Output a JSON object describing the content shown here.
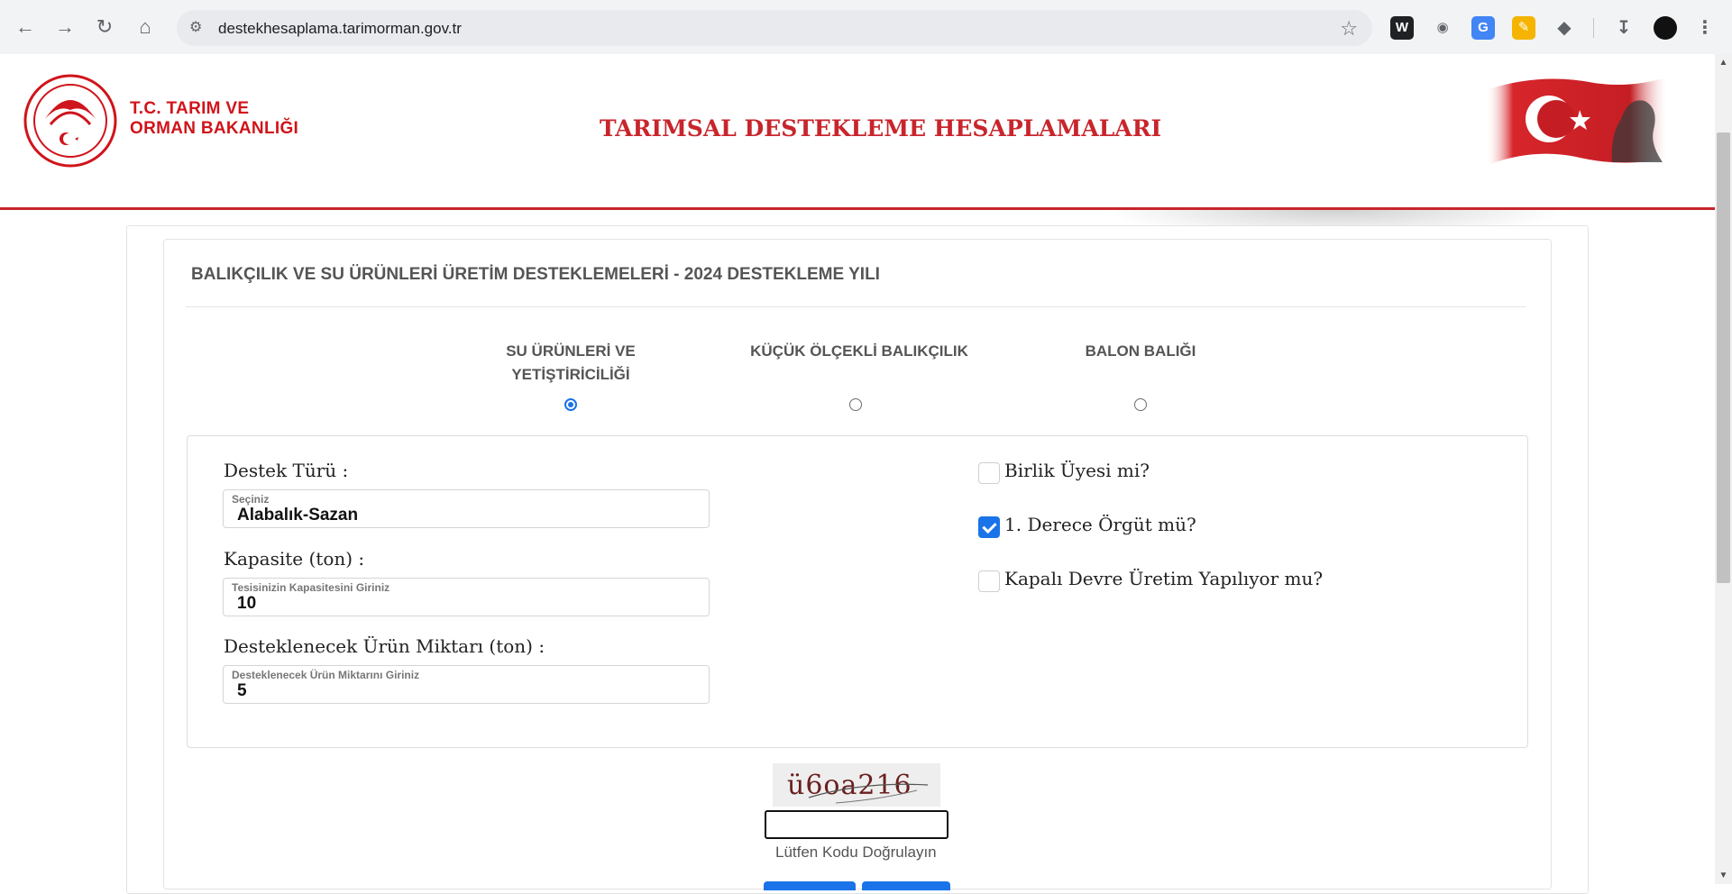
{
  "browser": {
    "url": "destekhesaplama.tarimorman.gov.tr"
  },
  "header": {
    "ministry_line1": "T.C. TARIM VE",
    "ministry_line2": "ORMAN BAKANLIĞI",
    "site_title": "TARIMSAL DESTEKLEME HESAPLAMALARI"
  },
  "card": {
    "title": "BALIKÇILIK VE SU ÜRÜNLERİ ÜRETİM DESTEKLEMELERİ - 2024 DESTEKLEME YILI",
    "options": [
      {
        "line1": "SU ÜRÜNLERİ VE",
        "line2": "YETİŞTİRİCİLİĞİ",
        "selected": true
      },
      {
        "line1": "KÜÇÜK ÖLÇEKLİ BALIKÇILIK",
        "line2": "",
        "selected": false
      },
      {
        "line1": "BALON BALIĞI",
        "line2": "",
        "selected": false
      }
    ]
  },
  "form": {
    "support_type": {
      "label": "Destek Türü :",
      "placeholder": "Seçiniz",
      "value": "Alabalık-Sazan"
    },
    "capacity": {
      "label": "Kapasite (ton) :",
      "placeholder": "Tesisinizin Kapasitesini Giriniz",
      "value": "10"
    },
    "amount": {
      "label": "Desteklenecek Ürün Miktarı (ton) :",
      "placeholder": "Desteklenecek Ürün Miktarını Giriniz",
      "value": "5"
    },
    "checks": [
      {
        "label": "Birlik Üyesi mi?",
        "checked": false
      },
      {
        "label": "1. Derece Örgüt mü?",
        "checked": true
      },
      {
        "label": "Kapalı Devre Üretim Yapılıyor mu?",
        "checked": false
      }
    ]
  },
  "captcha": {
    "code": "ü6oa216",
    "input_value": "",
    "hint": "Lütfen Kodu Doğrulayın"
  },
  "colors": {
    "brand_red": "#c8252c",
    "accent_blue": "#1a73e8"
  }
}
